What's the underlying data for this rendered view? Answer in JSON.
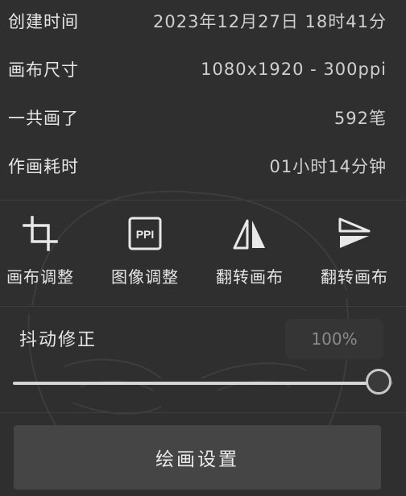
{
  "info": [
    {
      "label": "创建时间",
      "value": "2023年12月27日 18时41分"
    },
    {
      "label": "画布尺寸",
      "value": "1080x1920 - 300ppi"
    },
    {
      "label": "一共画了",
      "value": "592笔"
    },
    {
      "label": "作画耗时",
      "value": "01小时14分钟"
    }
  ],
  "tools": [
    {
      "label": "画布调整",
      "icon": "crop-icon"
    },
    {
      "label": "图像调整",
      "icon": "ppi-icon"
    },
    {
      "label": "翻转画布",
      "icon": "flip-horizontal-icon"
    },
    {
      "label": "翻转画布",
      "icon": "flip-vertical-icon"
    }
  ],
  "ppi_icon_text": "PPI",
  "stabilizer": {
    "label": "抖动修正",
    "value": "100%",
    "level": 1.0
  },
  "settings_button": "绘画设置",
  "colors": {
    "background": "#2f2f2f",
    "button": "#454545",
    "slider_fill": "#d6d6d6"
  }
}
